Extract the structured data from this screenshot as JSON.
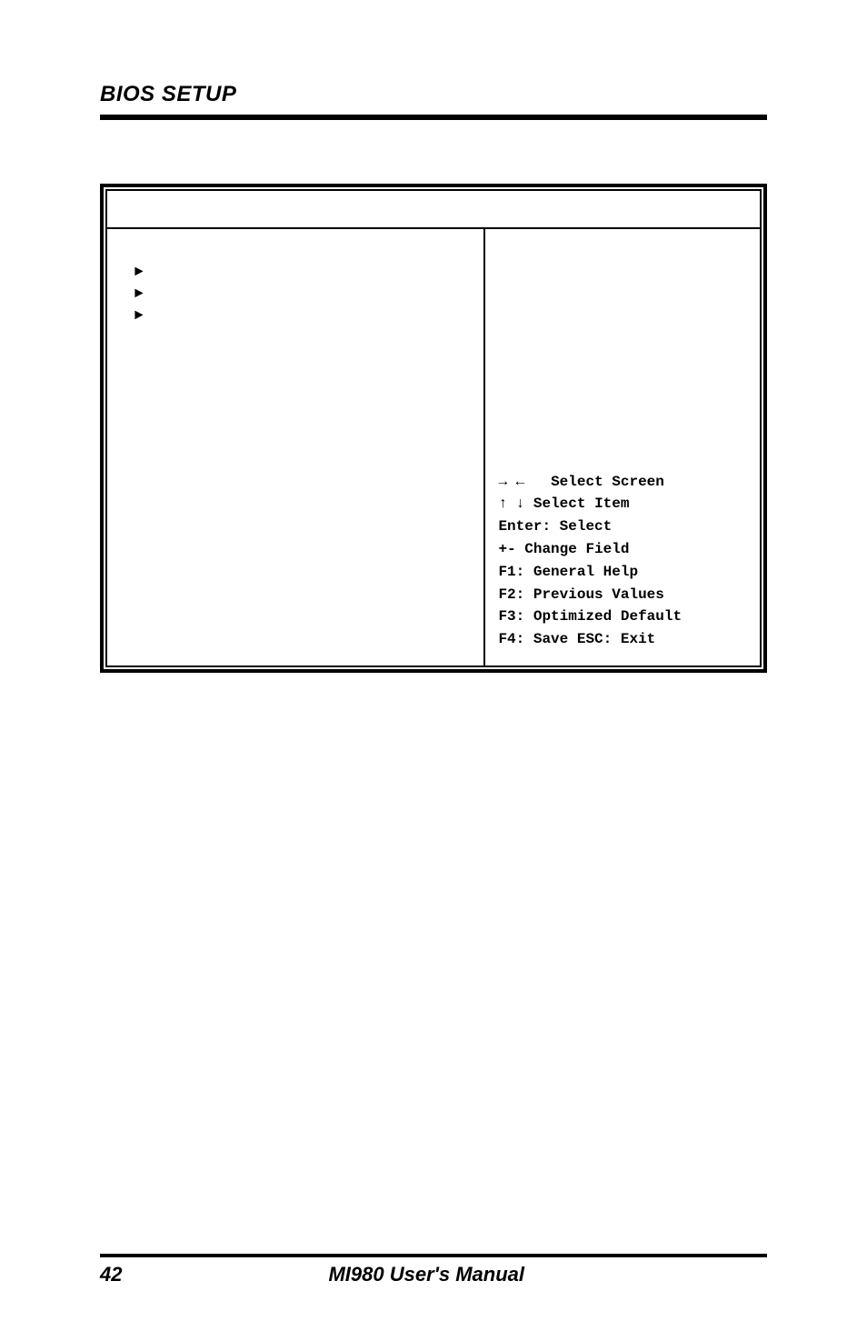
{
  "header": {
    "title": "BIOS SETUP"
  },
  "bios": {
    "left": {
      "markers": [
        "►",
        "►",
        "►"
      ]
    },
    "help": {
      "select_screen_arrows": "→ ←",
      "select_screen": "Select Screen",
      "select_item_arrows": "↑ ↓",
      "select_item": "Select Item",
      "enter": "Enter: Select",
      "change": "+-  Change Field",
      "f1": "F1: General Help",
      "f2": "F2: Previous Values",
      "f3": "F3: Optimized Default",
      "f4": "F4: Save  ESC: Exit"
    }
  },
  "footer": {
    "page": "42",
    "title": "MI980 User's Manual"
  }
}
